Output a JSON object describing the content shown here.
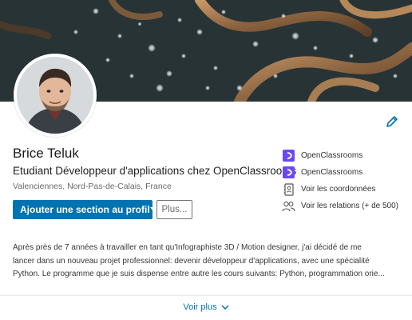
{
  "profile": {
    "name": "Brice Teluk",
    "headline": "Etudiant Développeur d'applications chez OpenClassrooms",
    "location": "Valenciennes, Nord-Pas-de-Calais, France"
  },
  "actions": {
    "add_section_label": "Ajouter une section au profil",
    "more_label": "Plus..."
  },
  "side": {
    "items": [
      {
        "label": "OpenClassrooms",
        "icon": "openclassrooms-logo"
      },
      {
        "label": "OpenClassrooms",
        "icon": "openclassrooms-logo"
      },
      {
        "label": "Voir les coordonnées",
        "icon": "contact-card-icon"
      },
      {
        "label": "Voir les relations (+ de 500)",
        "icon": "people-icon"
      }
    ]
  },
  "about": {
    "lines": [
      "Après près de 7 années à travailler en tant qu'Infographiste 3D / Motion designer, j'ai décidé de me",
      "lancer dans un nouveau projet professionnel: devenir développeur d'applications, avec une spécialité",
      "Python. Le programme que je suis dispense entre autre les cours suivants: Python, programmation orie..."
    ]
  },
  "footer": {
    "see_more_label": "Voir plus"
  },
  "colors": {
    "accent": "#0073b1",
    "openclassrooms": "#6a49f5"
  }
}
